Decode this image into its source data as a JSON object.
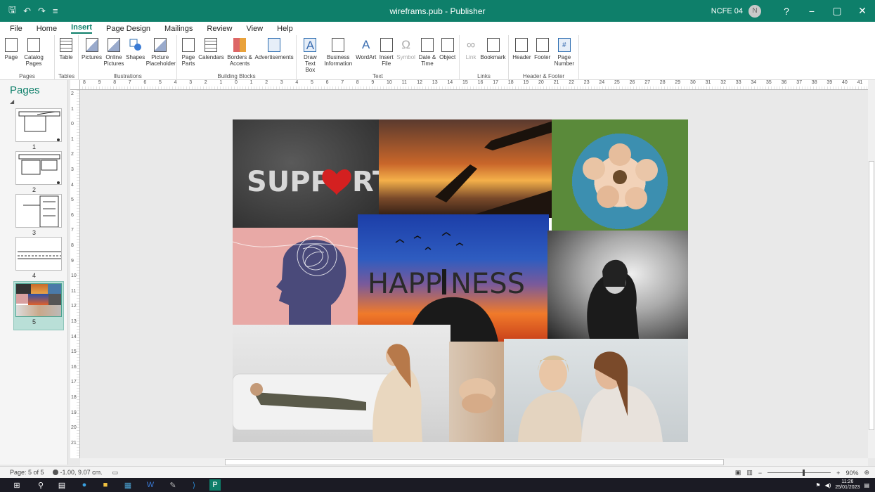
{
  "window": {
    "title": "wireframs.pub  -  Publisher",
    "user": "NCFE 04",
    "avatar_initial": "N",
    "help": "?",
    "minimize": "−",
    "restore": "▢",
    "close": "✕"
  },
  "qat": {
    "save": "🖫",
    "undo": "↶",
    "redo": "↷",
    "customize": "≡"
  },
  "tabs": [
    "File",
    "Home",
    "Insert",
    "Page Design",
    "Mailings",
    "Review",
    "View",
    "Help"
  ],
  "active_tab": "Insert",
  "ribbon": {
    "groups": {
      "pages": "Pages",
      "tables": "Tables",
      "illustrations": "Illustrations",
      "building_blocks": "Building Blocks",
      "text": "Text",
      "links": "Links",
      "header_footer": "Header & Footer"
    },
    "buttons": {
      "page": "Page",
      "catalog_pages": "Catalog Pages",
      "table": "Table",
      "pictures": "Pictures",
      "online_pictures": "Online Pictures",
      "shapes": "Shapes",
      "picture_placeholder": "Picture Placeholder",
      "page_parts": "Page Parts",
      "calendars": "Calendars",
      "borders_accents": "Borders & Accents",
      "advertisements": "Advertisements",
      "draw_text_box": "Draw Text Box",
      "business_information": "Business Information",
      "wordart": "WordArt",
      "insert_file": "Insert File",
      "symbol": "Symbol",
      "date_time": "Date & Time",
      "object": "Object",
      "link": "Link",
      "bookmark": "Bookmark",
      "header": "Header",
      "footer": "Footer",
      "page_number": "Page Number"
    }
  },
  "pages_panel": {
    "title": "Pages",
    "pages": [
      "1",
      "2",
      "3",
      "4",
      "5"
    ],
    "selected": 5
  },
  "ruler": {
    "h_numbers": [
      "8",
      "9",
      "8",
      "7",
      "6",
      "5",
      "4",
      "3",
      "2",
      "1",
      "0",
      "1",
      "2",
      "3",
      "4",
      "5",
      "6",
      "7",
      "8",
      "9",
      "10",
      "11",
      "12",
      "13",
      "14",
      "15",
      "16",
      "17",
      "18",
      "19",
      "20",
      "21",
      "22",
      "23",
      "24",
      "25",
      "26",
      "27",
      "28",
      "29",
      "30",
      "31",
      "32",
      "33",
      "34",
      "35",
      "36",
      "37",
      "38",
      "39",
      "40",
      "41"
    ],
    "v_numbers": [
      "2",
      "1",
      "0",
      "1",
      "2",
      "3",
      "4",
      "5",
      "6",
      "7",
      "8",
      "9",
      "10",
      "11",
      "12",
      "13",
      "14",
      "15",
      "16",
      "17",
      "18",
      "19",
      "20",
      "21"
    ]
  },
  "collage": {
    "support_text": "SUPP",
    "support_text_end": "RT",
    "happiness_text": "HAPP",
    "happiness_text_end": "NESS"
  },
  "status": {
    "page": "Page: 5 of 5",
    "position": "-1.00, 9.07 cm.",
    "zoom": "90%",
    "zoom_level": 0.55
  },
  "taskbar": {
    "time": "11:26",
    "date": "25/01/2023"
  },
  "colors": {
    "accent": "#0e7f6a",
    "taskbar": "#1b1b24"
  }
}
